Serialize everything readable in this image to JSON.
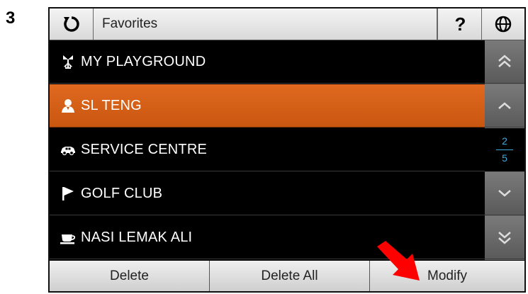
{
  "step_number": "3",
  "titlebar": {
    "refresh_icon": "refresh-icon",
    "title": "Favorites",
    "help_label": "?",
    "globe_icon": "globe-icon"
  },
  "favorites": [
    {
      "label": "MY PLAYGROUND",
      "icon": "playground-icon",
      "selected": false
    },
    {
      "label": "SL TENG",
      "icon": "person-icon",
      "selected": true
    },
    {
      "label": "SERVICE CENTRE",
      "icon": "car-icon",
      "selected": false
    },
    {
      "label": "GOLF CLUB",
      "icon": "flag-icon",
      "selected": false
    },
    {
      "label": "NASI LEMAK ALI",
      "icon": "cup-icon",
      "selected": false
    }
  ],
  "scrollbar": {
    "page_current": "2",
    "page_total": "5"
  },
  "buttons": {
    "delete": "Delete",
    "delete_all": "Delete All",
    "modify": "Modify"
  },
  "colors": {
    "selected_row": "#e0691f",
    "page_indicator": "#3fa9e0",
    "callout_arrow": "#ff0000"
  }
}
